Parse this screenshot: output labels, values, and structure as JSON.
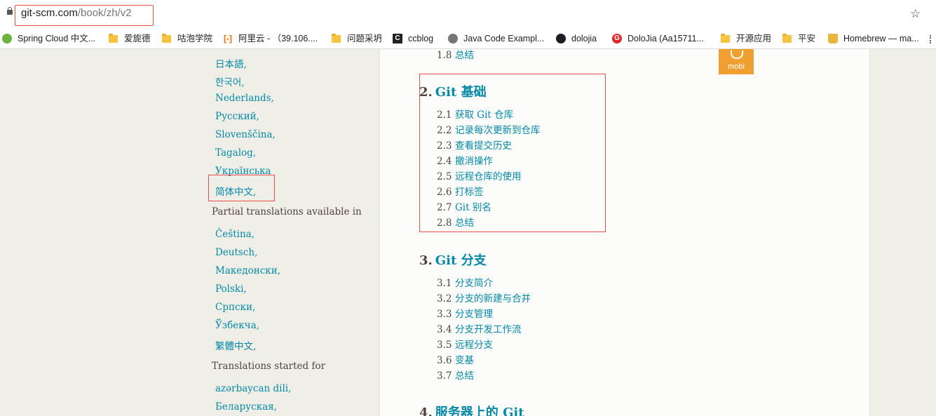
{
  "browser": {
    "url_host": "git-scm.com",
    "url_path": "/book/zh/v2",
    "bookmarks": [
      {
        "label": "Spring Cloud 中文...",
        "icon": "spring-icon"
      },
      {
        "label": "爱旎德",
        "icon": "folder-icon"
      },
      {
        "label": "咕泡学院",
        "icon": "folder-icon"
      },
      {
        "label": "阿里云 - （39.106....",
        "icon": "aliyun-icon"
      },
      {
        "label": "问题采坍",
        "icon": "folder-icon"
      },
      {
        "label": "ccblog",
        "icon": "ccblog-icon"
      },
      {
        "label": "Java Code Exampl...",
        "icon": "globe-icon"
      },
      {
        "label": "dolojia",
        "icon": "github-icon"
      },
      {
        "label": "DoloJia (Aa15711...",
        "icon": "gitee-icon"
      },
      {
        "label": "开源应用",
        "icon": "folder-icon"
      },
      {
        "label": "平安",
        "icon": "folder-icon"
      },
      {
        "label": "Homebrew — ma...",
        "icon": "homebrew-icon"
      }
    ]
  },
  "sidebar": {
    "full_languages": [
      "日本語,",
      "한국어,",
      "Nederlands,",
      "Русский,",
      "Slovenščina,",
      "Tagalog,",
      "Українська",
      "简体中文,"
    ],
    "partial_heading": "Partial translations available in",
    "partial_languages": [
      "Čeština,",
      "Deutsch,",
      "Македонски,",
      "Polski,",
      "Српски,",
      "Ўзбекча,",
      "繁體中文,"
    ],
    "started_heading": "Translations started for",
    "started_languages": [
      "azərbaycan dili,",
      "Беларуская,"
    ]
  },
  "content": {
    "prev_section": {
      "num": "1.8",
      "title": "总结"
    },
    "chapters": [
      {
        "num": "2.",
        "title": "Git 基础",
        "sections": [
          {
            "num": "2.1",
            "title": "获取 Git 仓库"
          },
          {
            "num": "2.2",
            "title": "记录每次更新到仓库"
          },
          {
            "num": "2.3",
            "title": "查看提交历史"
          },
          {
            "num": "2.4",
            "title": "撤消操作"
          },
          {
            "num": "2.5",
            "title": "远程仓库的使用"
          },
          {
            "num": "2.6",
            "title": "打标签"
          },
          {
            "num": "2.7",
            "title": "Git 别名"
          },
          {
            "num": "2.8",
            "title": "总结"
          }
        ]
      },
      {
        "num": "3.",
        "title": "Git 分支",
        "sections": [
          {
            "num": "3.1",
            "title": "分支简介"
          },
          {
            "num": "3.2",
            "title": "分支的新建与合并"
          },
          {
            "num": "3.3",
            "title": "分支管理"
          },
          {
            "num": "3.4",
            "title": "分支开发工作流"
          },
          {
            "num": "3.5",
            "title": "远程分支"
          },
          {
            "num": "3.6",
            "title": "变基"
          },
          {
            "num": "3.7",
            "title": "总结"
          }
        ]
      },
      {
        "num": "4.",
        "title": "服务器上的 Git",
        "sections": []
      }
    ],
    "download_label": "mobi"
  },
  "colors": {
    "link": "#0388a6",
    "text": "#4e443c",
    "highlight_box": "#ea4c4c",
    "mobi_bg": "#f0a030"
  }
}
